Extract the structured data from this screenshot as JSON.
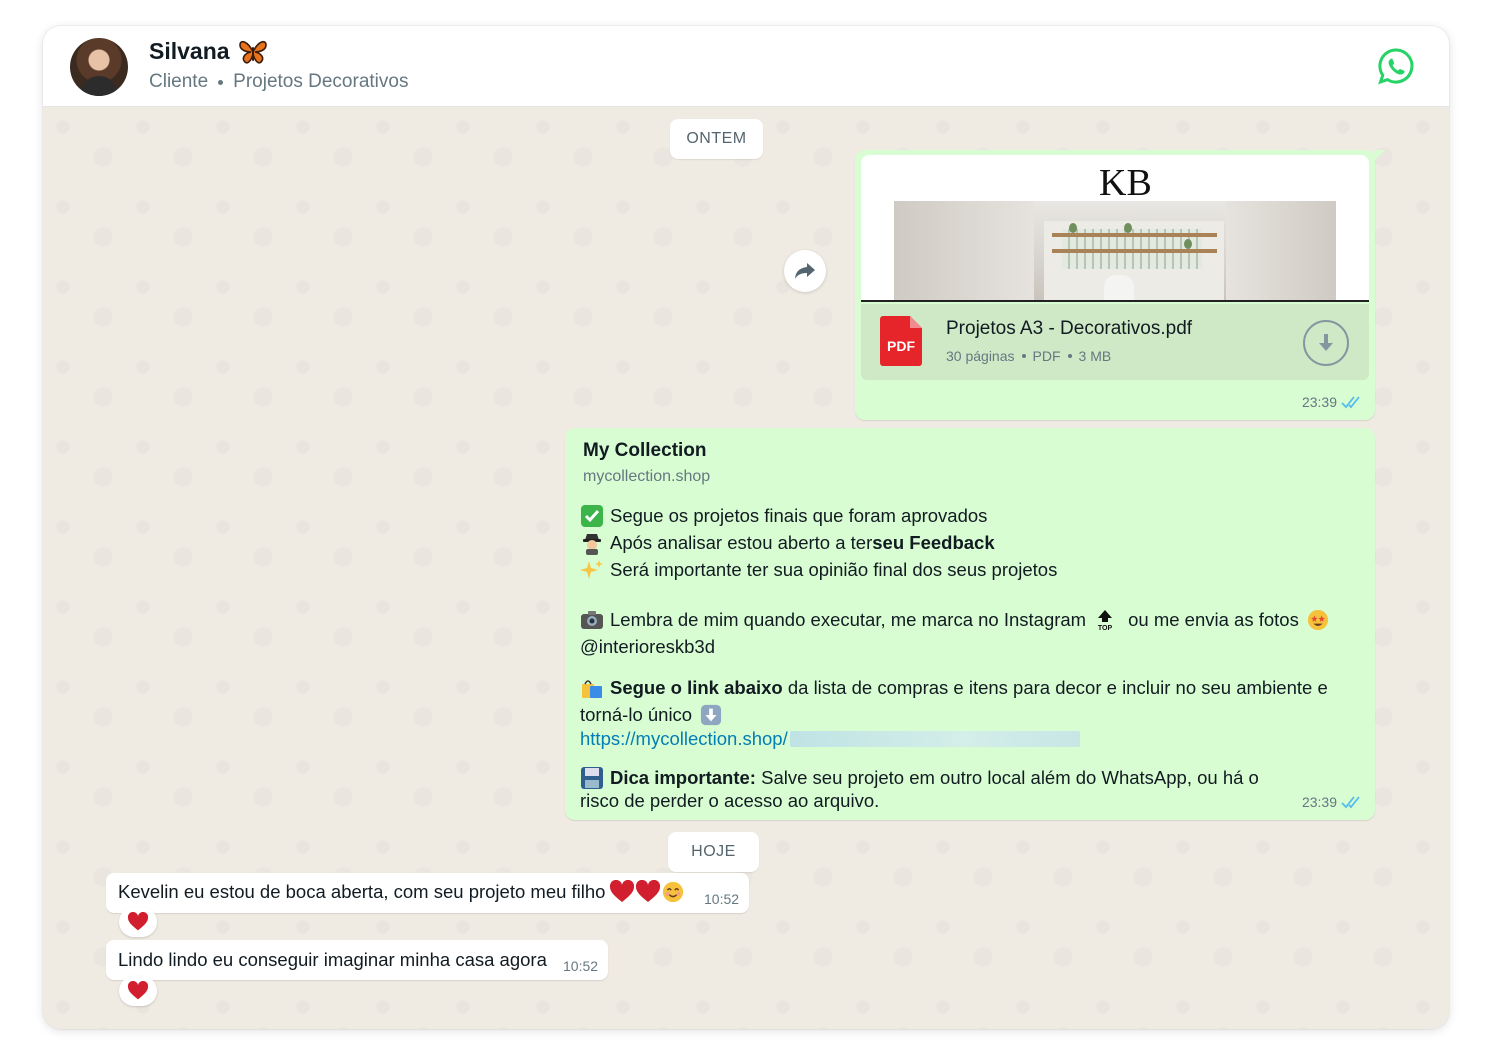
{
  "header": {
    "contact_name": "Silvana",
    "contact_role": "Cliente",
    "contact_group": "Projetos Decorativos",
    "name_emoji": "butterfly-emoji",
    "app_icon": "whatsapp-icon"
  },
  "chips": {
    "yesterday": "ONTEM",
    "today": "HOJE"
  },
  "doc_message": {
    "logo_text": "KB",
    "file_name": "Projetos A3 - Decorativos.pdf",
    "file_type_badge": "PDF",
    "pages": "30 páginas",
    "type": "PDF",
    "size": "3 MB",
    "time": "23:39"
  },
  "link_message": {
    "preview_title": "My Collection",
    "preview_domain": "mycollection.shop",
    "line1": "Segue os projetos finais que foram aprovados",
    "line2_a": "Após analisar estou aberto a ter ",
    "line2_b": "seu Feedback",
    "line3": "Será importante ter sua opinião final dos seus projetos",
    "line4_a": "Lembra de mim quando executar, me marca no Instagram",
    "line4_b": "ou me envia as fotos",
    "line5": "@interioreskb3d",
    "line6_a": "Segue o link abaixo",
    "line6_b": " da lista de compras e itens para decor e incluir no seu ambiente e",
    "line7": "torná-lo único",
    "url": "https://mycollection.shop/",
    "line8_a": "Dica importante:",
    "line8_b": " Salve seu projeto em outro local além do WhatsApp, ou há o",
    "line9": "risco de perder o acesso ao arquivo.",
    "time": "23:39"
  },
  "incoming": [
    {
      "text": "Kevelin eu estou de boca aberta, com seu projeto meu filho",
      "time": "10:52",
      "reaction": "heart-emoji"
    },
    {
      "text": "Lindo lindo eu conseguir imaginar minha casa agora",
      "time": "10:52",
      "reaction": "heart-emoji"
    }
  ],
  "colors": {
    "outgoing_bubble": "#d9fdd3",
    "chat_background": "#efeae2",
    "link_blue": "#027eb5",
    "read_tick_blue": "#53bdeb",
    "whatsapp_green": "#25d366"
  }
}
